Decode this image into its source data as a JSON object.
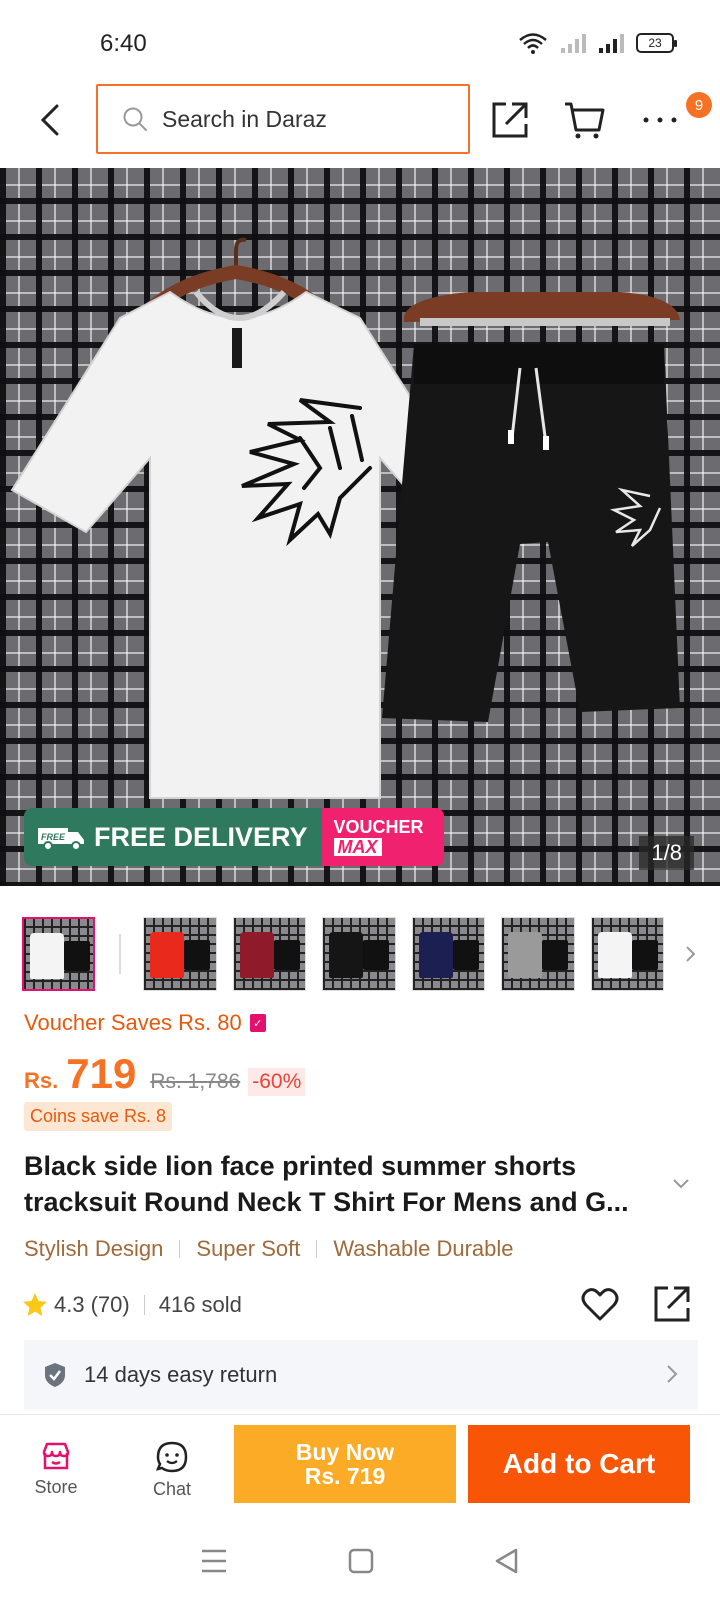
{
  "status": {
    "time": "6:40",
    "battery": "23"
  },
  "header": {
    "search_placeholder": "Search in Daraz",
    "cart_badge": "9"
  },
  "hero": {
    "free_delivery_tag": "FREE",
    "free_delivery": "FREE DELIVERY",
    "voucher_line1": "VOUCHER",
    "voucher_line2": "MAX",
    "image_counter": "1/8"
  },
  "thumbnails": [
    {
      "color": "#f4f4f4"
    },
    {
      "color": "#e8291c"
    },
    {
      "color": "#8e1a2a"
    },
    {
      "color": "#151515"
    },
    {
      "color": "#1c1f52"
    },
    {
      "color": "#9a9a9a"
    },
    {
      "color": "#f4f4f4"
    }
  ],
  "product": {
    "voucher_text": "Voucher Saves Rs. 80",
    "currency": "Rs.",
    "price": "719",
    "old_price": "Rs. 1,786",
    "discount": "-60%",
    "coins": "Coins save Rs. 8",
    "title": "Black side lion face printed summer shorts tracksuit Round Neck T Shirt For Mens and G...",
    "tags": [
      "Stylish Design",
      "Super Soft",
      "Washable Durable"
    ],
    "rating": "4.3",
    "reviews": "(70)",
    "sold": "416 sold",
    "return_policy": "14 days easy return"
  },
  "bottom": {
    "store": "Store",
    "chat": "Chat",
    "buy_now_line1": "Buy Now",
    "buy_now_line2": "Rs. 719",
    "add_to_cart": "Add to Cart"
  },
  "colors": {
    "accent": "#f57224",
    "buy_now": "#fbab25",
    "add_to_cart": "#f85606",
    "voucher_pink": "#f0216e",
    "delivery_green": "#2f7a5f"
  }
}
